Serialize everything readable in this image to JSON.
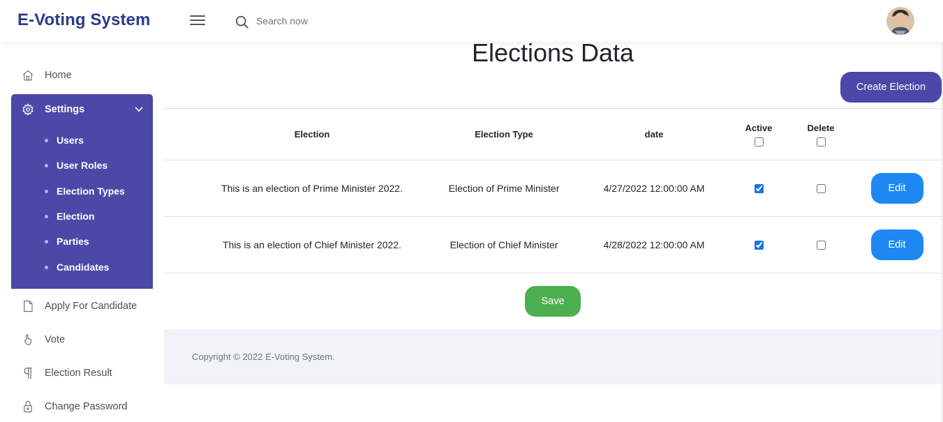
{
  "app": {
    "title": "E-Voting System"
  },
  "search": {
    "placeholder": "Search now",
    "value": ""
  },
  "sidebar": {
    "home": "Home",
    "settings": {
      "label": "Settings",
      "items": [
        "Users",
        "User Roles",
        "Election Types",
        "Election",
        "Parties",
        "Candidates"
      ]
    },
    "apply_for_candidate": "Apply For Candidate",
    "vote": "Vote",
    "election_result": "Election Result",
    "change_password": "Change Password"
  },
  "main": {
    "title": "Elections Data",
    "create_button": "Create Election",
    "table": {
      "headers": {
        "election": "Election",
        "election_type": "Election Type",
        "date": "date",
        "active": "Active",
        "delete": "Delete"
      },
      "rows": [
        {
          "election": "This is an election of Prime Minister 2022.",
          "election_type": "Election of Prime Minister",
          "date": "4/27/2022 12:00:00 AM",
          "active": true,
          "delete": false,
          "edit_label": "Edit"
        },
        {
          "election": "This is an election of Chief Minister 2022.",
          "election_type": "Election of Chief Minister",
          "date": "4/28/2022 12:00:00 AM",
          "active": true,
          "delete": false,
          "edit_label": "Edit"
        }
      ]
    },
    "save_button": "Save"
  },
  "footer": {
    "copyright": "Copyright © 2022 E-Voting System."
  },
  "colors": {
    "brand": "#2c3a8a",
    "sidebar_active": "#4b48a8",
    "edit": "#1e88f2",
    "save": "#4caf50",
    "footer_bg": "#f0f4f9"
  }
}
